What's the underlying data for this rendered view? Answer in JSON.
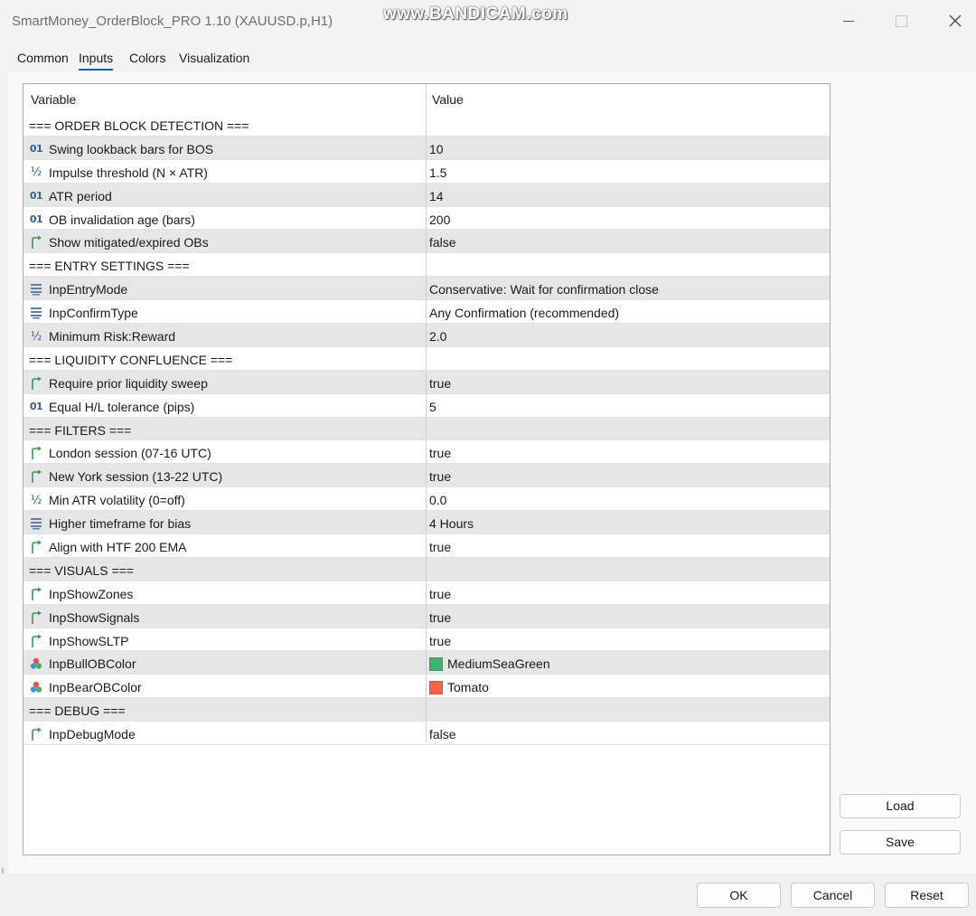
{
  "window": {
    "title": "SmartMoney_OrderBlock_PRO 1.10 (XAUUSD.p,H1)",
    "watermark": "www.BANDICAM.com"
  },
  "tabs": [
    {
      "label": "Common",
      "active": false
    },
    {
      "label": "Inputs",
      "active": true
    },
    {
      "label": "Colors",
      "active": false
    },
    {
      "label": "Visualization",
      "active": false
    }
  ],
  "table": {
    "headers": {
      "variable": "Variable",
      "value": "Value"
    },
    "rows": [
      {
        "icon": "",
        "variable": "=== ORDER BLOCK DETECTION ===",
        "value": ""
      },
      {
        "icon": "integer-icon",
        "variable": "Swing lookback bars for BOS",
        "value": "10"
      },
      {
        "icon": "fraction-icon",
        "variable": "Impulse threshold (N × ATR)",
        "value": "1.5"
      },
      {
        "icon": "integer-icon",
        "variable": "ATR period",
        "value": "14"
      },
      {
        "icon": "integer-icon",
        "variable": "OB invalidation age (bars)",
        "value": "200"
      },
      {
        "icon": "boolean-icon",
        "variable": "Show mitigated/expired OBs",
        "value": "false"
      },
      {
        "icon": "",
        "variable": "=== ENTRY SETTINGS ===",
        "value": ""
      },
      {
        "icon": "enum-icon",
        "variable": "InpEntryMode",
        "value": "Conservative: Wait for confirmation close"
      },
      {
        "icon": "enum-icon",
        "variable": "InpConfirmType",
        "value": "Any Confirmation (recommended)"
      },
      {
        "icon": "fraction-icon",
        "variable": "Minimum Risk:Reward",
        "value": "2.0"
      },
      {
        "icon": "",
        "variable": "=== LIQUIDITY CONFLUENCE ===",
        "value": ""
      },
      {
        "icon": "boolean-icon",
        "variable": "Require prior liquidity sweep",
        "value": "true"
      },
      {
        "icon": "integer-icon",
        "variable": "Equal H/L tolerance (pips)",
        "value": "5"
      },
      {
        "icon": "",
        "variable": "=== FILTERS ===",
        "value": ""
      },
      {
        "icon": "boolean-icon",
        "variable": "London session (07-16 UTC)",
        "value": "true"
      },
      {
        "icon": "boolean-icon",
        "variable": "New York session (13-22 UTC)",
        "value": "true"
      },
      {
        "icon": "fraction-icon",
        "variable": "Min ATR volatility (0=off)",
        "value": "0.0"
      },
      {
        "icon": "enum-icon",
        "variable": "Higher timeframe for bias",
        "value": "4 Hours"
      },
      {
        "icon": "boolean-icon",
        "variable": "Align with HTF 200 EMA",
        "value": "true"
      },
      {
        "icon": "",
        "variable": "=== VISUALS ===",
        "value": ""
      },
      {
        "icon": "boolean-icon",
        "variable": "InpShowZones",
        "value": "true"
      },
      {
        "icon": "boolean-icon",
        "variable": "InpShowSignals",
        "value": "true"
      },
      {
        "icon": "boolean-icon",
        "variable": "InpShowSLTP",
        "value": "true"
      },
      {
        "icon": "color-icon",
        "variable": "InpBullOBColor",
        "value": "MediumSeaGreen",
        "swatch": "#3cb371"
      },
      {
        "icon": "color-icon",
        "variable": "InpBearOBColor",
        "value": "Tomato",
        "swatch": "#ff6347"
      },
      {
        "icon": "",
        "variable": "=== DEBUG ===",
        "value": ""
      },
      {
        "icon": "boolean-icon",
        "variable": "InpDebugMode",
        "value": "false"
      }
    ]
  },
  "buttons": {
    "load": "Load",
    "save": "Save",
    "ok": "OK",
    "cancel": "Cancel",
    "reset": "Reset"
  },
  "colors": {
    "accent": "#0067c0",
    "boolean_icon": "#2e9e4e",
    "numeric_icon": "#2f5f9f"
  }
}
